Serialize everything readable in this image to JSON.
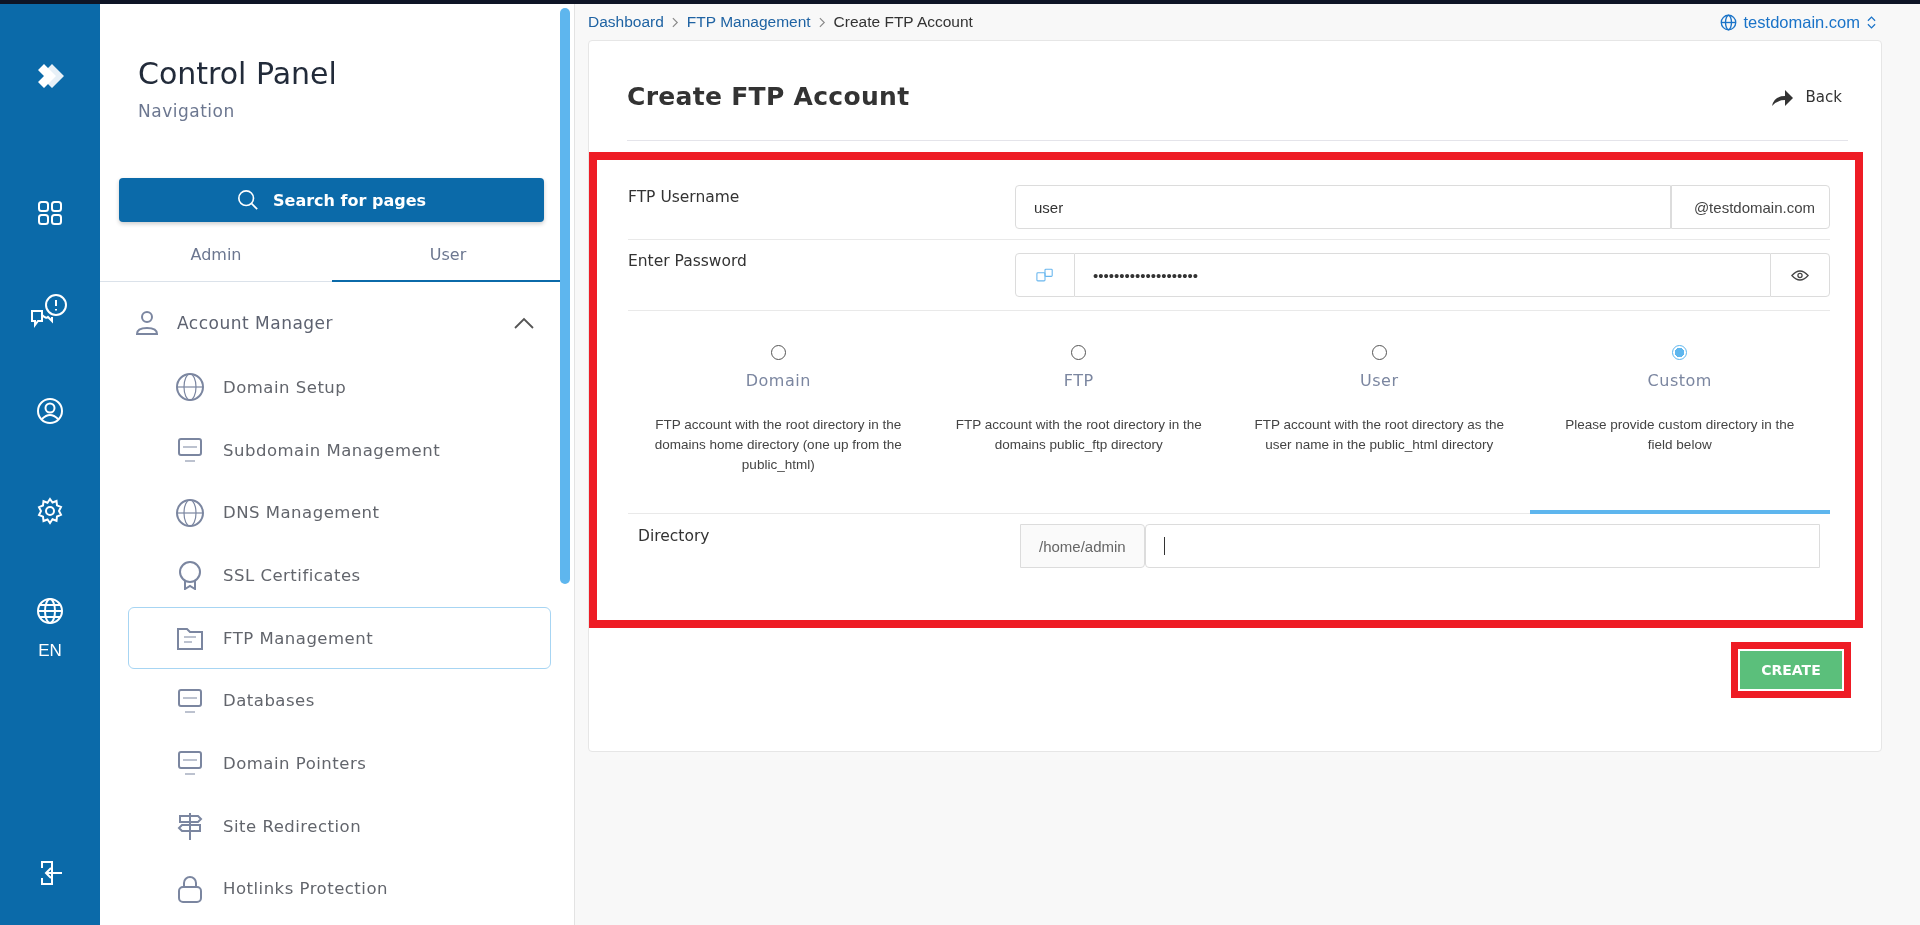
{
  "rail": {
    "language": "EN"
  },
  "sidebar": {
    "title": "Control Panel",
    "subtitle": "Navigation",
    "search_button": "Search for pages",
    "tabs": [
      {
        "label": "Admin",
        "selected": false
      },
      {
        "label": "User",
        "selected": true
      }
    ],
    "section": {
      "label": "Account Manager",
      "expanded": true,
      "items": [
        {
          "label": "Domain Setup",
          "selected": false
        },
        {
          "label": "Subdomain Management",
          "selected": false
        },
        {
          "label": "DNS Management",
          "selected": false
        },
        {
          "label": "SSL Certificates",
          "selected": false
        },
        {
          "label": "FTP Management",
          "selected": true
        },
        {
          "label": "Databases",
          "selected": false
        },
        {
          "label": "Domain Pointers",
          "selected": false
        },
        {
          "label": "Site Redirection",
          "selected": false
        },
        {
          "label": "Hotlinks Protection",
          "selected": false
        }
      ]
    }
  },
  "breadcrumb": [
    "Dashboard",
    "FTP Management",
    "Create FTP Account"
  ],
  "domain_selector": "testdomain.com",
  "page": {
    "title": "Create FTP Account",
    "back": "Back",
    "username": {
      "label": "FTP Username",
      "value": "user",
      "suffix": "@testdomain.com"
    },
    "password": {
      "label": "Enter Password",
      "value": "••••••••••••••••••••"
    },
    "directory_types": [
      {
        "label": "Domain",
        "description": "FTP account with the root directory in the domains home directory (one up from the public_html)",
        "selected": false
      },
      {
        "label": "FTP",
        "description": "FTP account with the root directory in the domains public_ftp directory",
        "selected": false
      },
      {
        "label": "User",
        "description": "FTP account with the root directory as the user name in the public_html directory",
        "selected": false
      },
      {
        "label": "Custom",
        "description": "Please provide custom directory in the field below",
        "selected": true
      }
    ],
    "directory": {
      "label": "Directory",
      "prefix": "/home/admin"
    },
    "create_button": "CREATE"
  }
}
